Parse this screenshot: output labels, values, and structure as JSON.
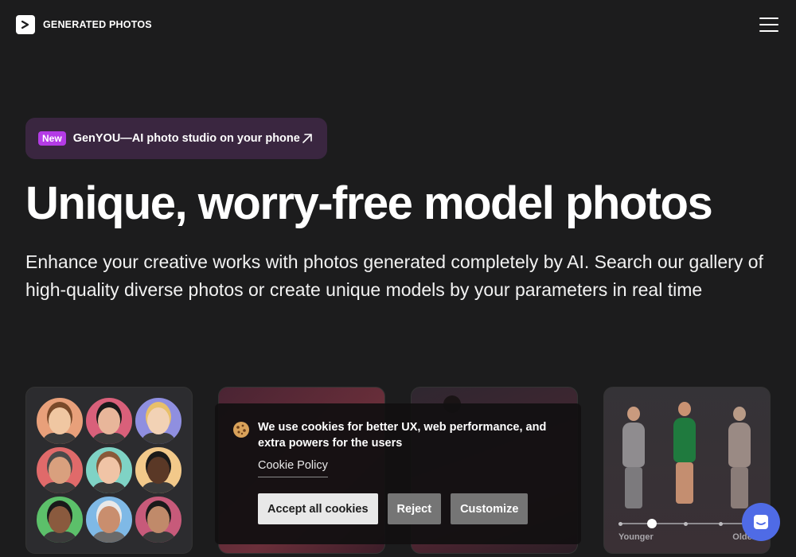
{
  "header": {
    "brand_name": "GENERATED PHOTOS",
    "logo_glyph": ">"
  },
  "promo": {
    "badge": "New",
    "text": "GenYOU—AI photo studio on your phone"
  },
  "hero": {
    "title": "Unique, worry-free model photos",
    "subtitle": "Enhance your creative works with photos generated completely by AI. Search our gallery of high-quality diverse photos or create unique models by your parameters in real time"
  },
  "cards": {
    "faces_colors": [
      "#e8a07a",
      "#d9607a",
      "#8f8fe0",
      "#e06a6a",
      "#7fd3c5",
      "#f2c98a",
      "#5cc06a",
      "#7fb9e6",
      "#c75a7a"
    ],
    "slider": {
      "left_label": "Younger",
      "right_label": "Older"
    }
  },
  "cookie_banner": {
    "message": "We use cookies for better UX, web performance, and extra powers for the users",
    "policy_link": "Cookie Policy",
    "accept_label": "Accept all cookies",
    "reject_label": "Reject",
    "customize_label": "Customize"
  },
  "colors": {
    "background": "#1c1c1d",
    "promo_bg": "#3a2640",
    "badge_bg": "#b43be6",
    "chat_bg": "#4f6be6"
  }
}
